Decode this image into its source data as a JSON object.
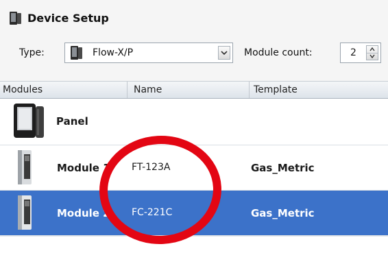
{
  "window": {
    "title": "Device Setup",
    "icon": "device-icon"
  },
  "toolbar": {
    "type_label": "Type:",
    "type_value": "Flow-X/P",
    "module_count_label": "Module count:",
    "module_count_value": "2"
  },
  "table": {
    "columns": [
      "Modules",
      "Name",
      "Template"
    ],
    "rows": [
      {
        "module": "Panel",
        "name": "",
        "template": "",
        "icon": "panel-device-icon",
        "selected": false
      },
      {
        "module": "Module 1",
        "name": "FT-123A",
        "template": "Gas_Metric",
        "icon": "module-device-icon",
        "selected": false
      },
      {
        "module": "Module 2",
        "name": "FC-221C",
        "template": "Gas_Metric",
        "icon": "module-device-icon",
        "selected": true
      }
    ]
  },
  "annotation": {
    "shape": "red-circle",
    "color": "#e30613"
  },
  "colors": {
    "selection": "#3c72c9",
    "toolbar_bg": "#f5f5f5"
  }
}
